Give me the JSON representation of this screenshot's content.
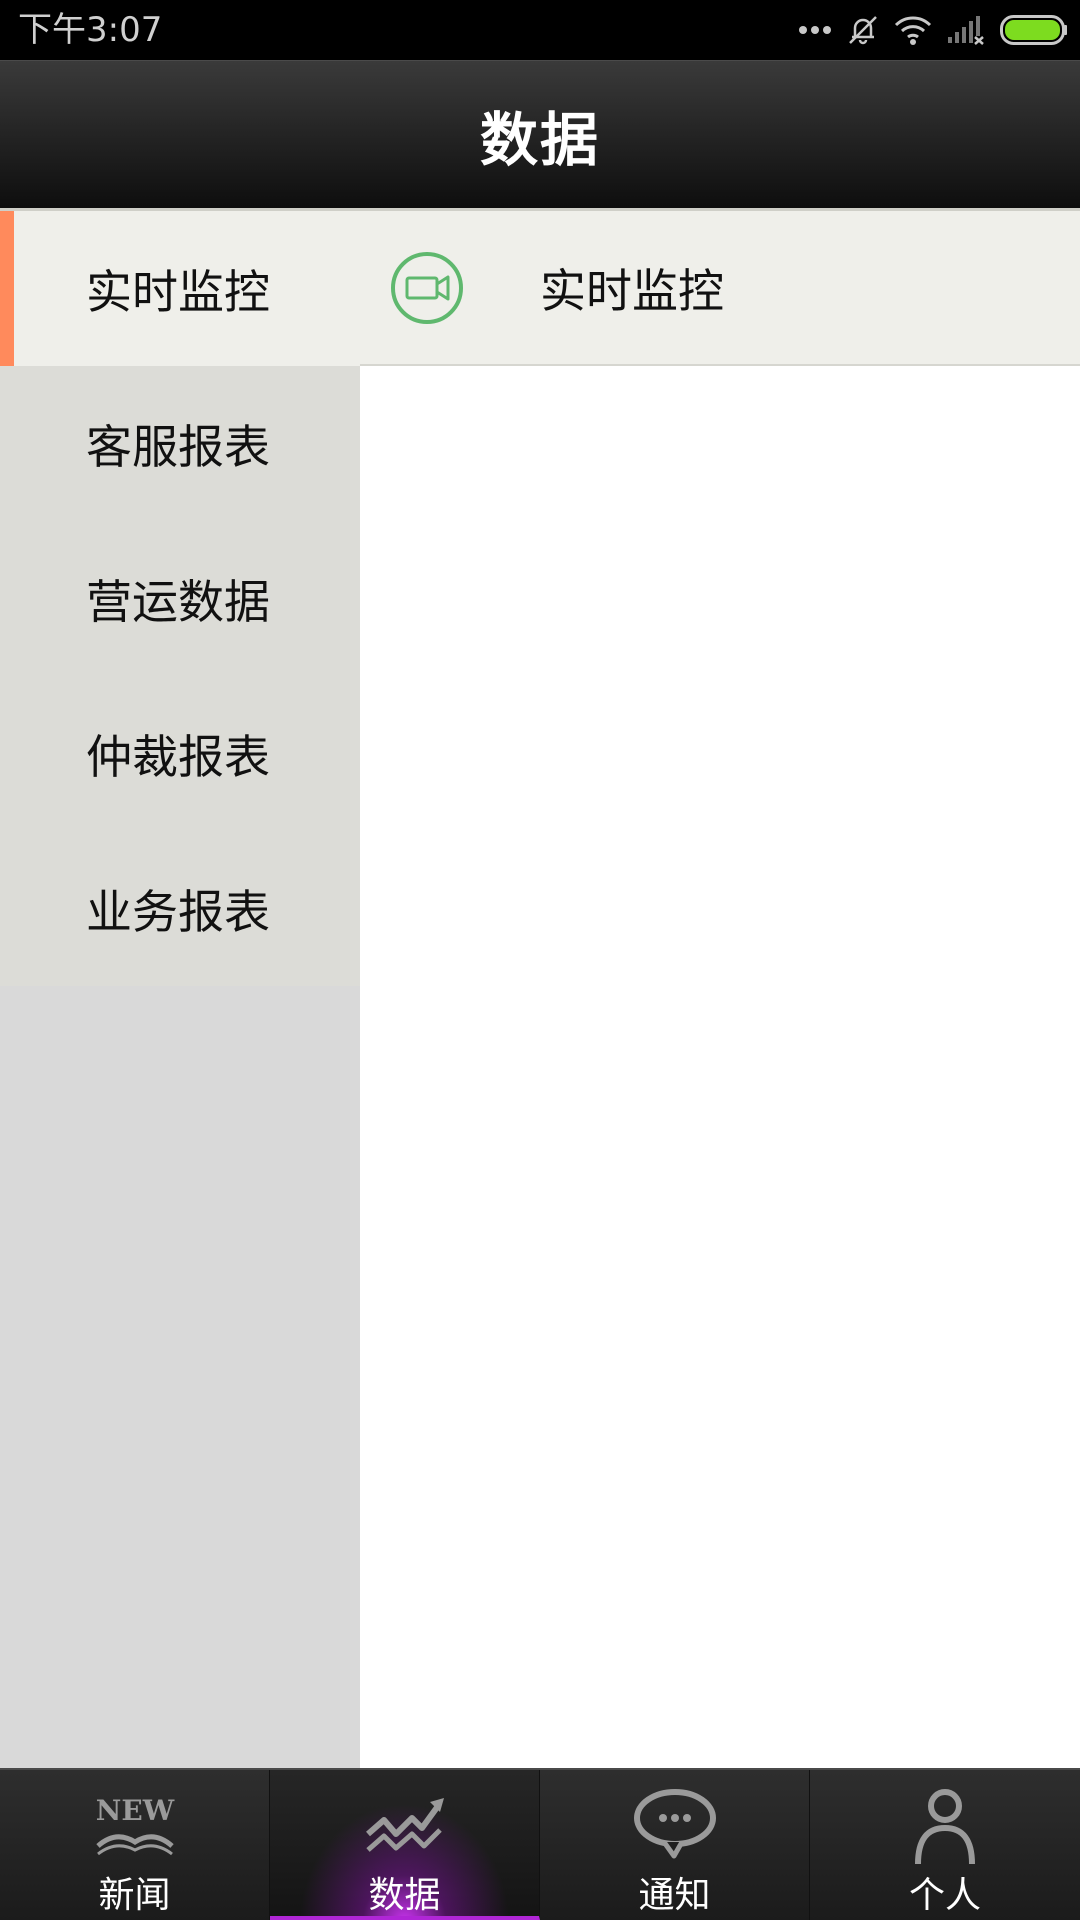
{
  "status_bar": {
    "time": "下午3:07",
    "icons": [
      "more-dots-icon",
      "mute-bell-icon",
      "wifi-icon",
      "no-signal-icon",
      "battery-full-icon"
    ],
    "battery_color": "#7ddc1f"
  },
  "header": {
    "title": "数据"
  },
  "sidebar": {
    "accent_color": "#ff8a5c",
    "items": [
      {
        "label": "实时监控",
        "active": true
      },
      {
        "label": "客服报表",
        "active": false
      },
      {
        "label": "营运数据",
        "active": false
      },
      {
        "label": "仲裁报表",
        "active": false
      },
      {
        "label": "业务报表",
        "active": false
      }
    ]
  },
  "main": {
    "sub_items": [
      {
        "icon": "video-camera-icon",
        "label": "实时监控",
        "icon_color": "#5fb86e"
      }
    ]
  },
  "tab_bar": {
    "active_color": "#b026d6",
    "tabs": [
      {
        "icon": "news-icon",
        "icon_text": "NEW",
        "label": "新闻",
        "active": false
      },
      {
        "icon": "chart-trend-icon",
        "label": "数据",
        "active": true
      },
      {
        "icon": "chat-bubble-icon",
        "label": "通知",
        "active": false
      },
      {
        "icon": "person-icon",
        "label": "个人",
        "active": false
      }
    ]
  }
}
